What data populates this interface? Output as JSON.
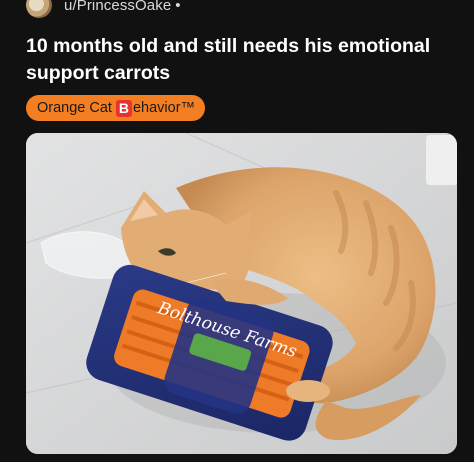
{
  "post": {
    "author": "u/PrincessOake",
    "separator": "•",
    "title": "10 months old and still needs his emotional support carrots",
    "flair": {
      "text_before": "Orange Cat ",
      "emoji_letter": "B",
      "text_after": "ehavior™",
      "background": "#f47f23",
      "emoji_color": "#e8322f"
    }
  },
  "image": {
    "description_icon": "photo-orange-cat-with-carrot-bag",
    "carrot_bag_brand": "Bolthouse Farms"
  }
}
